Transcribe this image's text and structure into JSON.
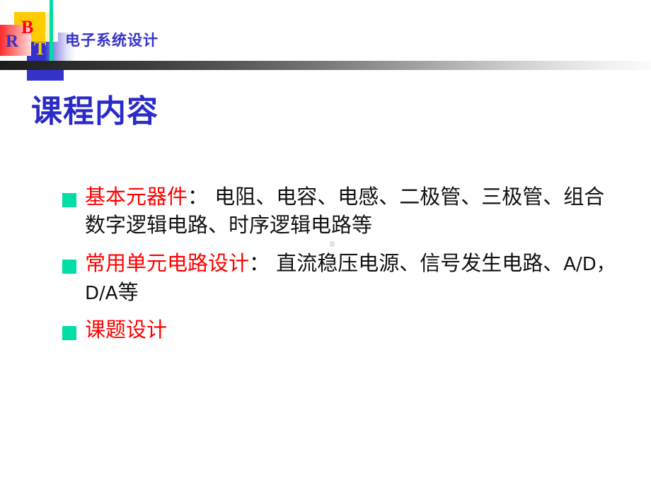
{
  "header": {
    "title": "电子系统设计",
    "logo": {
      "letters": [
        "B",
        "R",
        "T"
      ],
      "letter_b": "B",
      "letter_r": "R",
      "letter_t": "T",
      "colors": {
        "yellow": "#ffcc00",
        "blue": "#3333cc",
        "red": "#ff2b2b"
      }
    },
    "accent_color": "#00dda5",
    "title_color": "#3333cc",
    "gradient_from": "#1c1c1c",
    "gradient_to": "#fbfbfb"
  },
  "title": {
    "text": "课程内容",
    "color": "#2a2ac8"
  },
  "bullets": [
    {
      "marker_color": "#00dda5",
      "heading": "基本元器件",
      "heading_color": "#ff0000",
      "separator": "：",
      "detail": " 电阻、电容、电感、二极管、三极管、组合数字逻辑电路、时序逻辑电路等",
      "detail_color": "#111111"
    },
    {
      "marker_color": "#00dda5",
      "heading": " 常用单元电路设计",
      "heading_color": "#ff0000",
      "separator": "：",
      "detail_part1": " 直流稳压电源、信号发生电路、",
      "detail_sans": "A/D，D/A",
      "detail_part2": "等",
      "detail_color": "#111111"
    },
    {
      "marker_color": "#00dda5",
      "heading": "课题设计",
      "heading_color": "#ff0000",
      "separator": "",
      "detail": "",
      "detail_color": "#111111"
    }
  ]
}
